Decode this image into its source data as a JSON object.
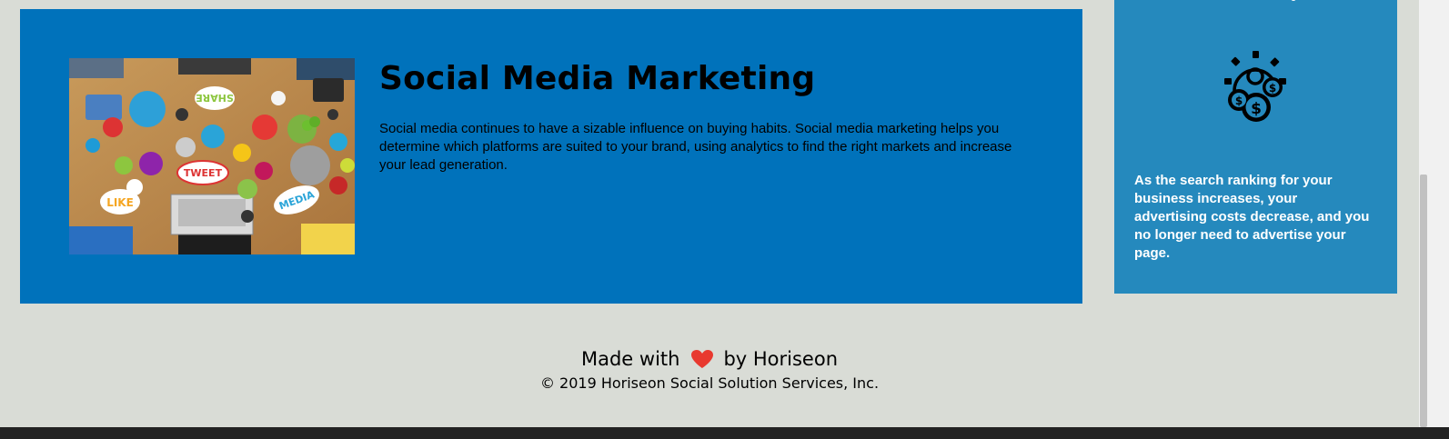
{
  "main_card": {
    "title": "Social Media Marketing",
    "text": "Social media continues to have a sizable influence on buying habits. Social media marketing helps you determine which platforms are suited to your brand, using analytics to find the right markets and increase your lead generation.",
    "image": {
      "bubble_labels": [
        "SHARE",
        "TWEET",
        "LIKE",
        "MEDIA"
      ]
    }
  },
  "benefit_card": {
    "icon": "cost-savings-gear-icon",
    "text": "As the search ranking for your business increases, your advertising costs decrease, and you no longer need to advertise your page."
  },
  "footer": {
    "made_prefix": "Made with",
    "made_suffix": "by Horiseon",
    "heart_icon": "heart-icon",
    "copyright": "© 2019 Horiseon Social Solution Services, Inc."
  },
  "colors": {
    "page_background": "#d9dcd6",
    "main_card": "#0072bb",
    "benefit_card": "#2589bd",
    "heart": "#e8392f"
  }
}
